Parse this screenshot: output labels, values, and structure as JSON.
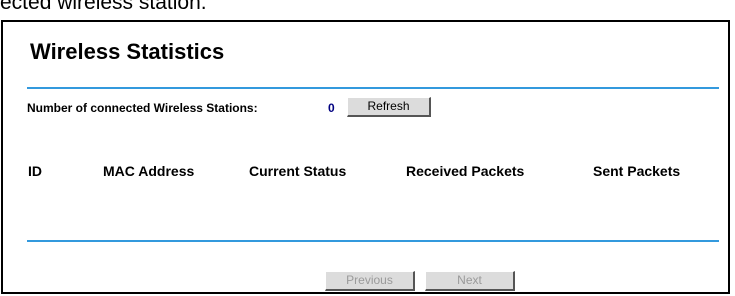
{
  "caption_fragment": "ected wireless station.",
  "title": "Wireless Statistics",
  "stations": {
    "label": "Number of connected Wireless Stations:",
    "count": "0",
    "refresh_label": "Refresh"
  },
  "table": {
    "columns": [
      "ID",
      "MAC Address",
      "Current Status",
      "Received Packets",
      "Sent Packets"
    ],
    "rows": []
  },
  "pagination": {
    "previous_label": "Previous",
    "next_label": "Next"
  },
  "colors": {
    "rule": "#3399dd",
    "count": "#000080"
  }
}
